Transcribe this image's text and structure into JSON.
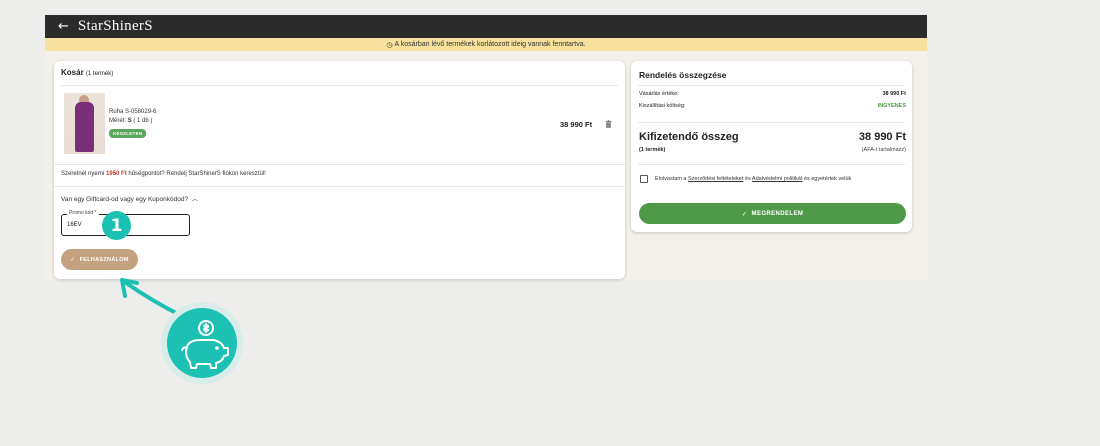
{
  "header": {
    "logo": "StarShinerS"
  },
  "notice": {
    "text": "A kosárban lévő termékek korlátozott ideig vannak fenntartva."
  },
  "cart": {
    "title": "Kosár",
    "count": "(1 termék)",
    "product": {
      "name": "Ruha S-058029-6",
      "size_label": "Méret:",
      "size_value": "S",
      "qty": "( 1 db )",
      "badge": "KÉSZLETEN",
      "price": "38 990 Ft"
    },
    "points": {
      "before": "Szeretnél nyerni ",
      "amount": "1950 Ft",
      "after": " hűségpontot? Rendelj StarShinerS fiókon keresztül!"
    },
    "gift_question": "Van egy Giftcard-od vagy egy Kuponkódod?",
    "promo": {
      "label": "Promo kód *",
      "value": "16EV"
    },
    "apply_button": "FELHASZNÁLOM"
  },
  "summary": {
    "title": "Rendelés összegzése",
    "rows": [
      {
        "label": "Vásárlás értéke:",
        "value": "38 990 Ft"
      },
      {
        "label": "Kiszállítási költség:",
        "value": "INGYENES"
      }
    ],
    "total_label": "Kifizetendő összeg",
    "total_value": "38 990 Ft",
    "total_count": "(1 termék)",
    "vat_note": "(ÁFA-t tartalmazz)",
    "accept": {
      "pre": "Elolvastam a ",
      "link1": "Szerződési feltételeket",
      "mid": " és ",
      "link2": "Adatvédelmi politikát",
      "post": " és egyetértek velük"
    },
    "order_button": "MEGRENDELEM"
  },
  "annotation": {
    "step": "1"
  },
  "colors": {
    "accent_teal": "#1cc1b4",
    "order_green": "#4f9a46",
    "apply_tan": "#c4a27f",
    "notice_yellow": "#f7e19c",
    "topbar": "#2b2b2b"
  },
  "icons": [
    "back-arrow-icon",
    "clock-icon",
    "trash-icon",
    "chevron-up-icon",
    "checkmark-icon",
    "piggy-bank-icon"
  ]
}
